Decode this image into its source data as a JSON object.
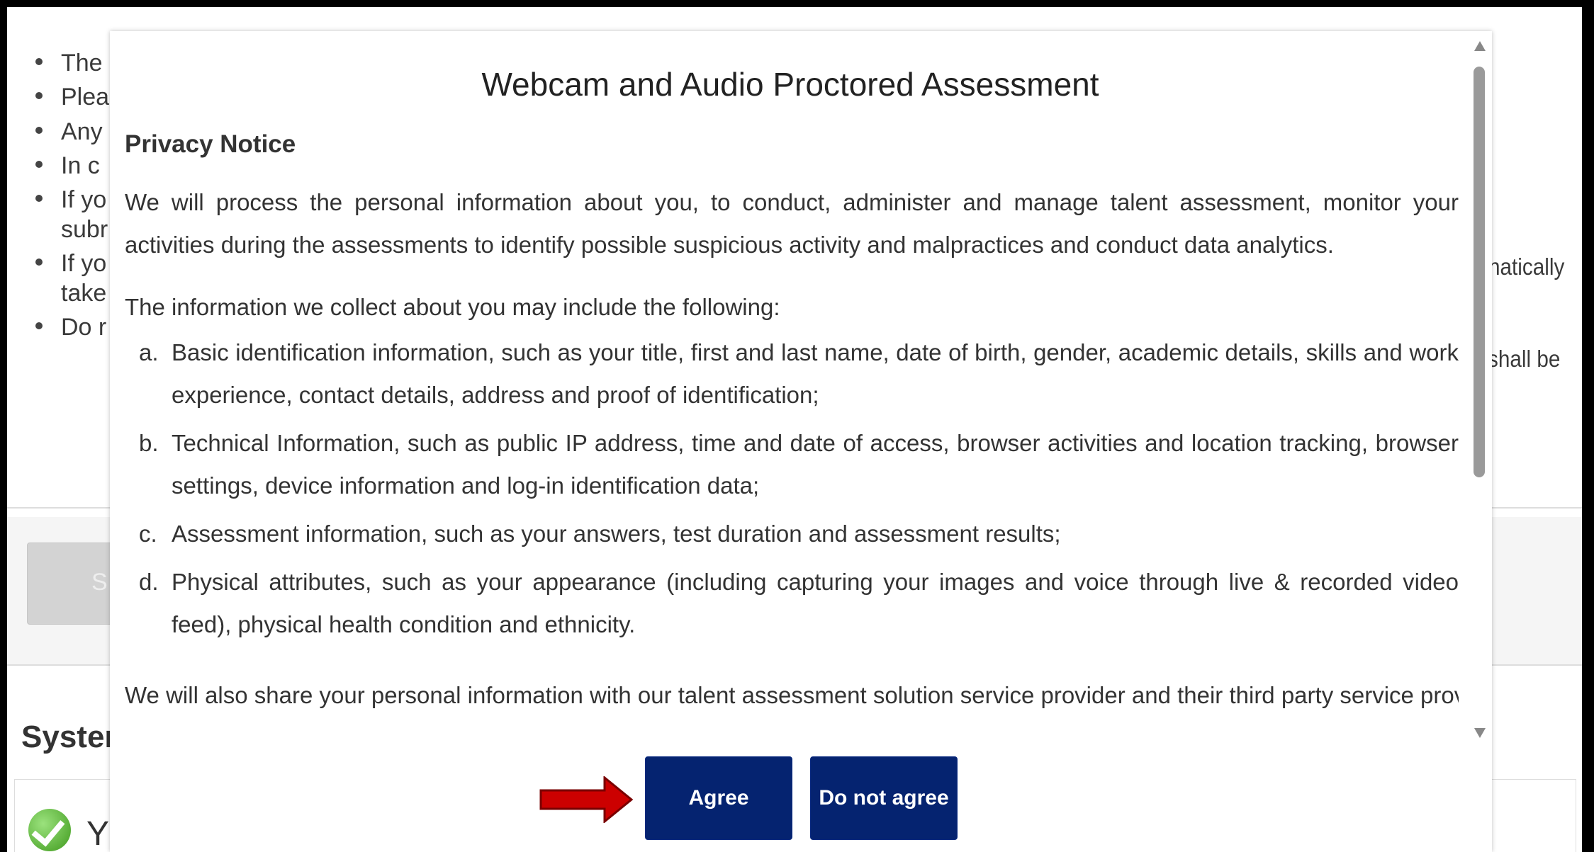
{
  "background": {
    "bullets": [
      "The",
      "Plea",
      "Any",
      "In c",
      "If yo",
      "subr",
      "If yo",
      "take",
      "Do r"
    ],
    "right_fragments": [
      "natically",
      "shall be"
    ],
    "button_fragment": "S",
    "section_heading": "Systen",
    "status_fragment": "Y"
  },
  "modal": {
    "title": "Webcam and Audio Proctored Assessment",
    "privacy_heading": "Privacy Notice",
    "paragraph1": "We will process the personal information about you, to conduct, administer and manage talent assessment, monitor your activities during the assessments to identify possible suspicious activity and malpractices and conduct data analytics.",
    "list_intro": "The information we collect about you may include the following:",
    "items": [
      {
        "marker": "a.",
        "text": "Basic identification information, such as your title, first and last name, date of birth, gender, academic details, skills and work experience, contact details, address and proof of identification;"
      },
      {
        "marker": "b.",
        "text": "Technical Information, such as public IP address, time and date of access, browser activities and location tracking, browser settings, device information and log-in identification data;"
      },
      {
        "marker": "c.",
        "text": "Assessment information, such as your answers, test duration and assessment results;"
      },
      {
        "marker": "d.",
        "text": "Physical attributes, such as your appearance (including capturing your images and voice through live & recorded video feed), physical health condition and ethnicity."
      }
    ],
    "paragraph2_partial": "We will also share your personal information with our talent assessment solution service provider and their third party service providers including",
    "agree_label": "Agree",
    "disagree_label": "Do not agree"
  },
  "colors": {
    "button_bg": "#052370",
    "arrow": "#cc0000"
  },
  "icons": [
    "check-icon",
    "arrow-right-icon",
    "scroll-up-icon",
    "scroll-down-icon"
  ]
}
